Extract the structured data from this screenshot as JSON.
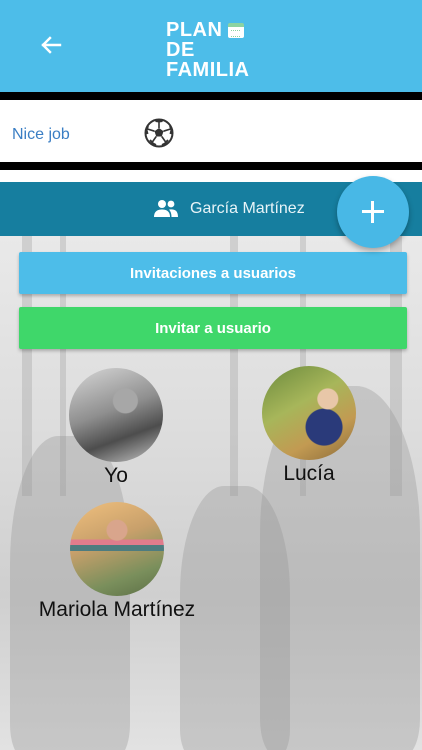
{
  "header": {
    "back_icon": "arrow-left-icon",
    "logo_line1": "PLAN",
    "logo_line2": "DE FAMILIA",
    "logo_icon": "calendar-icon",
    "background_color": "#4dbde9"
  },
  "activity": {
    "label": "Nice job",
    "icon": "soccer-ball-icon"
  },
  "family": {
    "icon": "people-icon",
    "name": "García Martínez",
    "bar_color": "#167e9f"
  },
  "fab": {
    "icon": "plus-icon"
  },
  "buttons": {
    "invitations_label": "Invitaciones a usuarios",
    "invitations_color": "#4dbde9",
    "invite_label": "Invitar a usuario",
    "invite_color": "#3fd76a"
  },
  "members": [
    {
      "name": "Yo"
    },
    {
      "name": "Lucía"
    },
    {
      "name": "Mariola Martínez"
    }
  ]
}
